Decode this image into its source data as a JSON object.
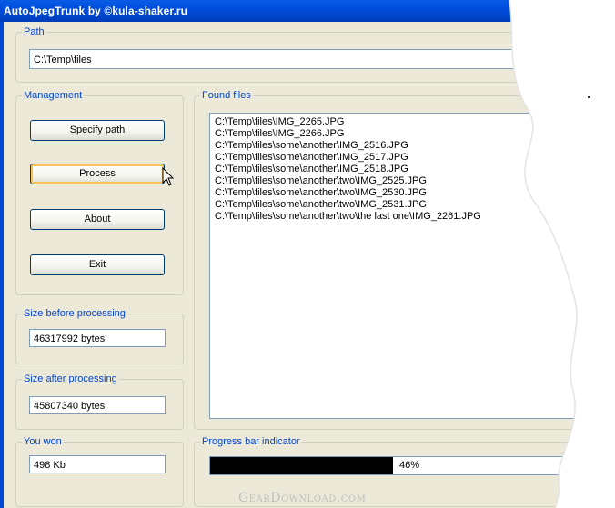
{
  "window": {
    "title": "AutoJpegTrunk by ©kula-shaker.ru"
  },
  "path": {
    "label": "Path",
    "value": "C:\\Temp\\files"
  },
  "management": {
    "label": "Management",
    "buttons": [
      "Specify path",
      "Process",
      "About",
      "Exit"
    ]
  },
  "found_files": {
    "label": "Found files",
    "items": [
      "C:\\Temp\\files\\IMG_2265.JPG",
      "C:\\Temp\\files\\IMG_2266.JPG",
      "C:\\Temp\\files\\some\\another\\IMG_2516.JPG",
      "C:\\Temp\\files\\some\\another\\IMG_2517.JPG",
      "C:\\Temp\\files\\some\\another\\IMG_2518.JPG",
      "C:\\Temp\\files\\some\\another\\two\\IMG_2525.JPG",
      "C:\\Temp\\files\\some\\another\\two\\IMG_2530.JPG",
      "C:\\Temp\\files\\some\\another\\two\\IMG_2531.JPG",
      "C:\\Temp\\files\\some\\another\\two\\the last one\\IMG_2261.JPG"
    ]
  },
  "size_before": {
    "label": "Size before processing",
    "value": "46317992 bytes"
  },
  "size_after": {
    "label": "Size after processing",
    "value": "45807340 bytes"
  },
  "you_won": {
    "label": "You won",
    "value": "498 Kb"
  },
  "progress": {
    "label": "Progress bar indicator",
    "text": "46%",
    "fraction": 0.46
  },
  "watermark": "GearDownload.com",
  "colors": {
    "titlebar": "#0054e3",
    "groupbox_label": "#0046d5",
    "dialog_bg": "#ece9d8",
    "progress_fill": "#000000"
  }
}
